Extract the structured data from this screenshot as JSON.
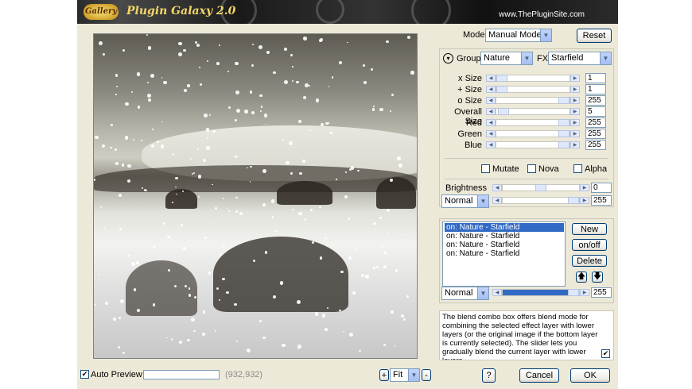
{
  "banner": {
    "logo_text": "Gallery",
    "title": "Plugin Galaxy 2.0",
    "site": "www.ThePluginSite.com"
  },
  "mode": {
    "label": "Mode",
    "value": "Manual Mode",
    "reset": "Reset"
  },
  "group": {
    "label": "Group:",
    "value": "Nature",
    "fx_label": "FX:",
    "fx_value": "Starfield"
  },
  "params": [
    {
      "label": "x Size",
      "value": "1",
      "fraction": 0.0
    },
    {
      "label": "+ Size",
      "value": "1",
      "fraction": 0.0
    },
    {
      "label": "o Size",
      "value": "255",
      "fraction": 1.0
    },
    {
      "label": "Overall Size",
      "value": "5",
      "fraction": 0.02
    },
    {
      "label": "Red",
      "value": "255",
      "fraction": 1.0
    },
    {
      "label": "Green",
      "value": "255",
      "fraction": 1.0
    },
    {
      "label": "Blue",
      "value": "255",
      "fraction": 1.0
    }
  ],
  "checks": [
    {
      "label": "Mutate",
      "checked": false
    },
    {
      "label": "Nova",
      "checked": false
    },
    {
      "label": "Alpha",
      "checked": false
    }
  ],
  "brightness": {
    "label": "Brightness",
    "value": "0",
    "fraction": 0.5
  },
  "blend1": {
    "mode": "Normal",
    "value": "255",
    "fraction": 1.0
  },
  "layers": [
    "on:  Nature - Starfield",
    "on:  Nature - Starfield",
    "on:  Nature - Starfield",
    "on:  Nature - Starfield"
  ],
  "layer_buttons": {
    "new": "New",
    "onoff": "on/off",
    "delete": "Delete",
    "up": "🡅",
    "down": "🡇"
  },
  "blend2": {
    "mode": "Normal",
    "value": "255",
    "fraction": 1.0
  },
  "help_text": "The blend combo box offers blend mode for combining the selected effect layer with lower layers (or the original image if the bottom layer is currently selected). The slider lets you gradually blend the current layer with lower layers.",
  "bottom": {
    "auto_preview": "Auto Preview",
    "auto_checked": "✔",
    "coords": "(932,932)",
    "zoom_in": "+",
    "zoom_value": "Fit",
    "zoom_out": "-",
    "help": "?",
    "cancel": "Cancel",
    "ok": "OK"
  },
  "colors": {
    "accent": "#003c74",
    "selection": "#316ac5",
    "window": "#ece9d8"
  }
}
